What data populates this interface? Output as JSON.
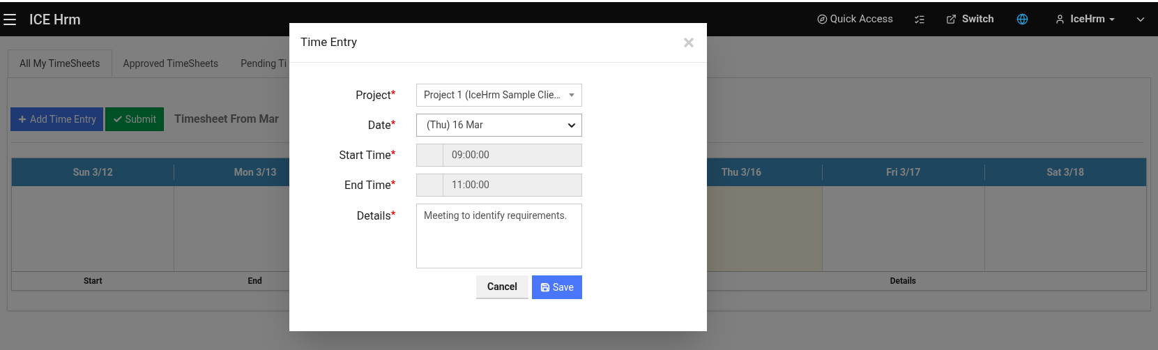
{
  "navbar": {
    "brand": "ICE Hrm",
    "quick_access": "Quick Access",
    "switch": "Switch",
    "user": "IceHrm"
  },
  "tabs": [
    {
      "label": "All My TimeSheets",
      "selected": true
    },
    {
      "label": "Approved TimeSheets",
      "selected": false
    },
    {
      "label": "Pending Ti",
      "selected": false
    }
  ],
  "actions": {
    "add": "Add Time Entry",
    "submit": "Submit",
    "timesheet_title": "Timesheet From Mar"
  },
  "calendar": {
    "days_left": [
      {
        "label": "Sun 3/12",
        "highlighted": false
      },
      {
        "label": "Mon 3/13",
        "highlighted": false
      }
    ],
    "days_right": [
      {
        "label": "Thu 3/16",
        "highlighted": true
      },
      {
        "label": "Fri 3/17",
        "highlighted": false
      },
      {
        "label": "Sat 3/18",
        "highlighted": false
      }
    ],
    "footer": [
      "Start",
      "End",
      "Details"
    ]
  },
  "modal": {
    "title": "Time Entry",
    "fields": [
      {
        "kind": "select",
        "label": "Project",
        "mark": "*",
        "value": "Project 1 (IceHrm Sample Clie…"
      },
      {
        "kind": "dropdown",
        "label": "Date",
        "mark": "*",
        "value": "(Thu) 16 Mar"
      },
      {
        "kind": "time",
        "label": "Start Time",
        "mark": "*",
        "value": "09:00:00"
      },
      {
        "kind": "time",
        "label": "End Time",
        "mark": "*",
        "value": "11:00:00"
      },
      {
        "kind": "textarea",
        "label": "Details",
        "mark": "*",
        "value": "Meeting to identify requirements."
      }
    ],
    "cancel": "Cancel",
    "save": "Save"
  }
}
